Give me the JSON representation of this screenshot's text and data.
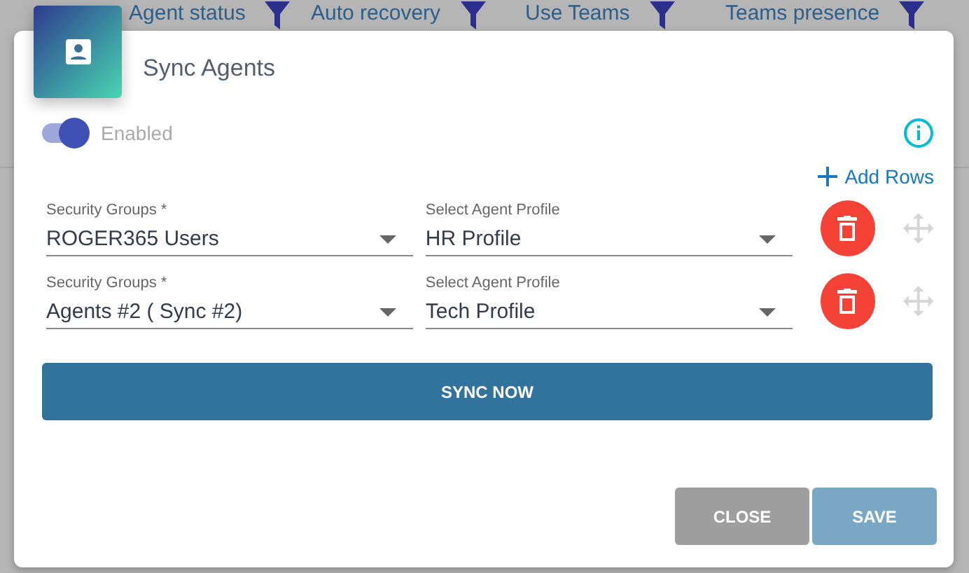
{
  "table_header": {
    "columns": [
      {
        "label": "Agent status"
      },
      {
        "label": "Auto recovery"
      },
      {
        "label": "Use Teams"
      },
      {
        "label": "Teams presence"
      }
    ]
  },
  "dialog": {
    "title": "Sync Agents",
    "enabled_toggle": {
      "label": "Enabled",
      "on": true
    },
    "add_rows": "Add Rows",
    "rows": [
      {
        "group_label": "Security Groups *",
        "group_value": "ROGER365 Users",
        "profile_label": "Select Agent Profile",
        "profile_value": "HR Profile"
      },
      {
        "group_label": "Security Groups *",
        "group_value": "Agents #2 ( Sync #2)",
        "profile_label": "Select Agent Profile",
        "profile_value": "Tech Profile"
      }
    ],
    "sync_button": "SYNC NOW",
    "buttons": [
      {
        "label": "CLOSE",
        "kind": "close"
      },
      {
        "label": "SAVE",
        "kind": "save"
      }
    ]
  }
}
